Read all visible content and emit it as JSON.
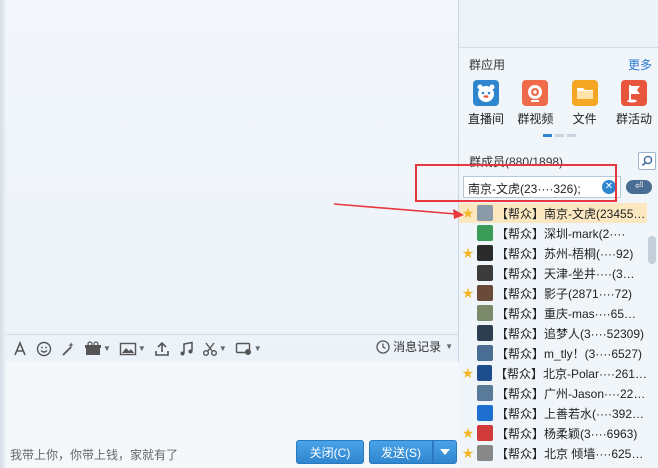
{
  "toolbar": {
    "items": [
      "font-icon",
      "emoji-icon",
      "magic-wand-icon",
      "gift-icon",
      "image-icon",
      "upload-icon",
      "music-icon",
      "scissors-icon",
      "screen-icon"
    ],
    "history_label": "消息记录"
  },
  "input": {
    "hint": "我带上你，你带上钱，家就有了"
  },
  "buttons": {
    "close_label": "关闭(C)",
    "send_label": "发送(S)",
    "send_dropdown_icon": "triangle-down-icon"
  },
  "group_apps": {
    "header": "群应用",
    "more": "更多",
    "items": [
      {
        "label": "直播间",
        "icon": "live-room-icon",
        "color": "#2f86cf"
      },
      {
        "label": "群视频",
        "icon": "group-video-icon",
        "color": "#ef6b4a"
      },
      {
        "label": "文件",
        "icon": "folder-icon",
        "color": "#f5a623"
      },
      {
        "label": "群活动",
        "icon": "activity-flag-icon",
        "color": "#e8553d"
      }
    ]
  },
  "members": {
    "header": "群成员(880/1898)",
    "search_value": "南京-文虎(23····326);",
    "list": [
      {
        "text": "【帮众】南京-文虎(23455…",
        "star": true,
        "selected": true,
        "avatar": "#8a9aa8"
      },
      {
        "text": "【帮众】深圳-mark(2····",
        "star": false,
        "selected": false,
        "avatar": "#3a9a58"
      },
      {
        "text": "【帮众】苏州-梧桐(····92)",
        "star": true,
        "selected": false,
        "avatar": "#2a2a2a"
      },
      {
        "text": "【帮众】天津-坐井····(3…",
        "star": false,
        "selected": false,
        "avatar": "#3b3b3b"
      },
      {
        "text": "【帮众】影子(2871····72)",
        "star": true,
        "selected": false,
        "avatar": "#6a4a3a"
      },
      {
        "text": "【帮众】重庆-mas····65…",
        "star": false,
        "selected": false,
        "avatar": "#7a8a6a"
      },
      {
        "text": "【帮众】追梦人(3····52309)",
        "star": false,
        "selected": false,
        "avatar": "#2c3e50"
      },
      {
        "text": "【帮众】m_tly！(3····6527)",
        "star": false,
        "selected": false,
        "avatar": "#4a6e93"
      },
      {
        "text": "【帮众】北京-Polar····261…",
        "star": true,
        "selected": false,
        "avatar": "#1e4d8c"
      },
      {
        "text": "【帮众】广州-Jason····22…",
        "star": false,
        "selected": false,
        "avatar": "#5a7a9a"
      },
      {
        "text": "【帮众】上善若水(····392…",
        "star": false,
        "selected": false,
        "avatar": "#1f6fd0"
      },
      {
        "text": "【帮众】杨柔颖(3····6963)",
        "star": true,
        "selected": false,
        "avatar": "#d13a3a"
      },
      {
        "text": "【帮众】北京 倾墙····625…",
        "star": true,
        "selected": false,
        "avatar": "#888888"
      }
    ]
  },
  "annotation": {
    "color": "#e8383d"
  }
}
